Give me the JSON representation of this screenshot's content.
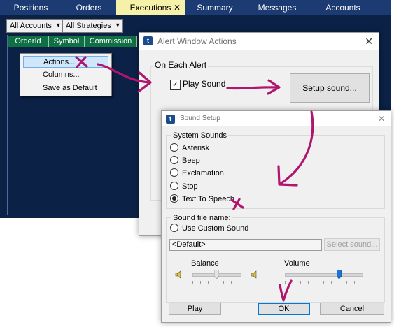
{
  "tabs": [
    {
      "label": "Positions",
      "active": false
    },
    {
      "label": "Orders",
      "active": false
    },
    {
      "label": "Executions",
      "active": true,
      "close": "✕"
    },
    {
      "label": "Summary",
      "active": false
    },
    {
      "label": "Messages",
      "active": false
    },
    {
      "label": "Accounts",
      "active": false
    }
  ],
  "filters": {
    "accounts": "All Accounts",
    "strategies": "All Strategies"
  },
  "columns": [
    "OrderId",
    "Symbol",
    "Commission"
  ],
  "context_menu": {
    "items": [
      "Actions...",
      "Columns...",
      "Save as Default"
    ],
    "highlighted": 0
  },
  "alert_dialog": {
    "title": "Alert Window Actions",
    "group": "On Each Alert",
    "play_sound_label": "Play Sound",
    "play_sound_checked": true,
    "setup_button": "Setup sound..."
  },
  "sound_dialog": {
    "title": "Sound Setup",
    "system_sounds_label": "System Sounds",
    "options": [
      "Asterisk",
      "Beep",
      "Exclamation",
      "Stop",
      "Text To Speech"
    ],
    "selected": "Text To Speech",
    "file_name_label": "Sound file name:",
    "custom_label": "Use Custom Sound",
    "file_value": "<Default>",
    "select_button": "Select sound...",
    "balance_label": "Balance",
    "volume_label": "Volume",
    "balance_value": 0.5,
    "volume_value": 0.7,
    "buttons": {
      "play": "Play",
      "ok": "OK",
      "cancel": "Cancel"
    }
  },
  "colors": {
    "annotation": "#b0166e",
    "tab_active": "#f6f1a8",
    "grid_header": "#0f7044",
    "window_bg": "#0b2146"
  }
}
